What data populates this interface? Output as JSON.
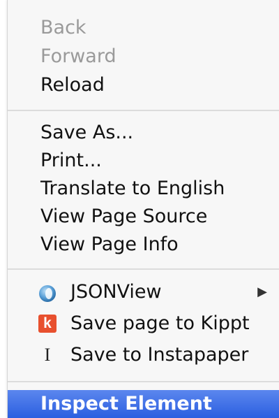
{
  "menu": {
    "items": [
      {
        "label": "Back"
      },
      {
        "label": "Forward"
      },
      {
        "label": "Reload"
      },
      {
        "label": "Save As..."
      },
      {
        "label": "Print..."
      },
      {
        "label": "Translate to English"
      },
      {
        "label": "View Page Source"
      },
      {
        "label": "View Page Info"
      },
      {
        "label": "JSONView",
        "icon": "jsonview-icon",
        "submenu_arrow": "▶"
      },
      {
        "label": "Save page to Kippt",
        "icon": "kippt-icon",
        "icon_glyph": "k"
      },
      {
        "label": "Save to Instapaper",
        "icon": "instapaper-icon",
        "icon_glyph": "I"
      },
      {
        "label": "Inspect Element"
      }
    ],
    "disabled_color": "#9a9a9a",
    "highlight_color": "#2b5fe0"
  }
}
